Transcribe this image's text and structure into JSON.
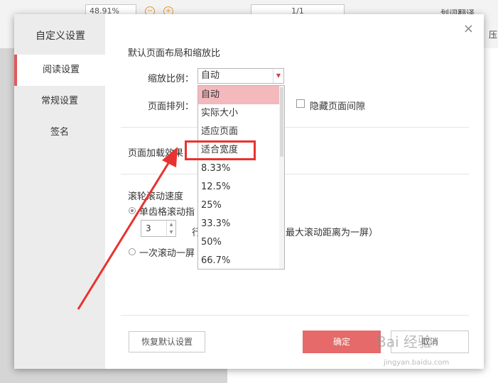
{
  "toolbar": {
    "zoom_value": "48.91%",
    "page_value": "1/1",
    "translate_label": "划词翻译",
    "zoom_out_glyph": "−",
    "zoom_in_glyph": "+",
    "compress_label": "压"
  },
  "dialog": {
    "title": "自定义设置",
    "close_glyph": "×",
    "sidebar": [
      {
        "label": "阅读设置",
        "active": true
      },
      {
        "label": "常规设置",
        "active": false
      },
      {
        "label": "签名",
        "active": false
      }
    ],
    "section_layout_title": "默认页面布局和缩放比",
    "zoom_label": "缩放比例：",
    "zoom_selected": "自动",
    "arrange_label": "页面排列：",
    "hide_gap_label": "隐藏页面间隙",
    "load_effect_label": "页面加载效果：",
    "scroll_title": "滚轮滚动速度",
    "scroll_option1": "单齿格滚动指",
    "scroll_lines_value": "3",
    "scroll_lines_suffix": "行",
    "scroll_max_note": "最大滚动距离为一屏）",
    "scroll_option2": "一次滚动一屏",
    "dropdown_options": [
      "自动",
      "实际大小",
      "适应页面",
      "适合宽度",
      "8.33%",
      "12.5%",
      "25%",
      "33.3%",
      "50%",
      "66.7%"
    ],
    "restore_button": "恢复默认设置",
    "ok_button": "确定",
    "cancel_button": "取消"
  },
  "watermark": {
    "text": "Bai 经验",
    "sub": "jingyan.baidu.com"
  },
  "colors": {
    "accent": "#e66a6a",
    "highlight_red": "#e8322f",
    "selected_bg": "#f3b9bd"
  }
}
